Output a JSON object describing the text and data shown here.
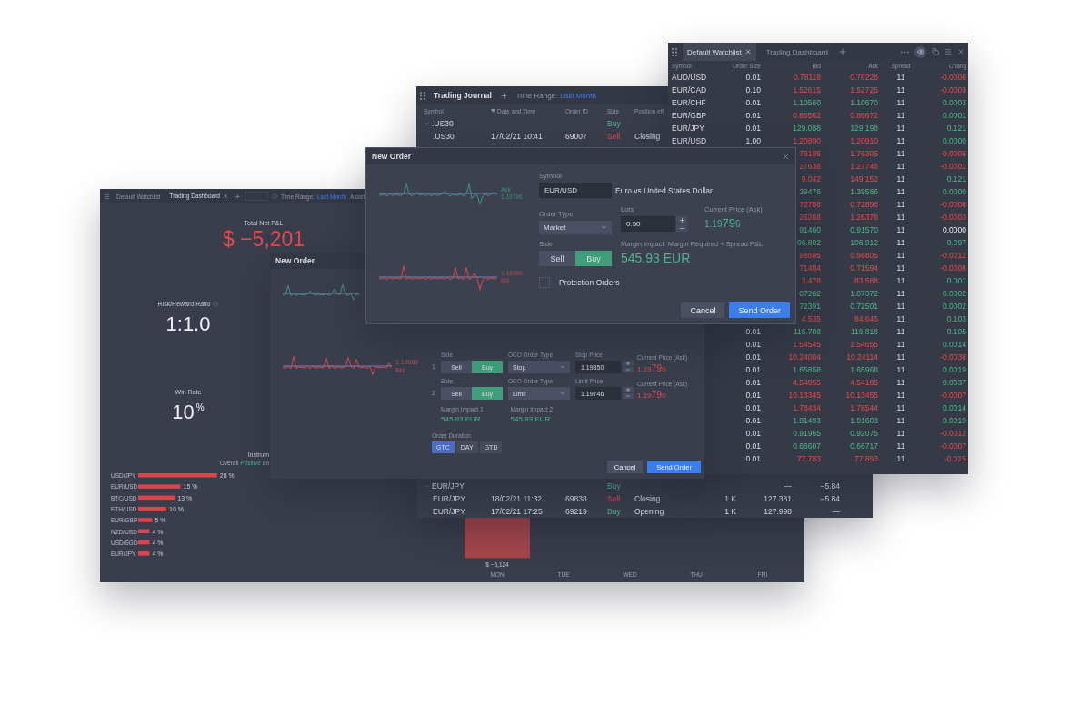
{
  "dashboard": {
    "tabs": [
      {
        "label": "Default Watchlist",
        "selected": false,
        "closable": false
      },
      {
        "label": "Trading Dashboard",
        "selected": true,
        "closable": true
      }
    ],
    "time_range": {
      "label": "Time Range:",
      "value": "Last Month"
    },
    "asset_label": "Asset",
    "total_pnl": {
      "label": "Total Net P&L",
      "value": "$ −5,201"
    },
    "risk_reward": {
      "label": "Risk/Reward Ratio",
      "value": "1:1.0"
    },
    "win_rate": {
      "label": "Win Rate",
      "value": "10",
      "unit": "%"
    },
    "instruments": {
      "title": "Instrum",
      "summary": [
        {
          "text": "Overall",
          "highlighted": false
        },
        {
          "text": "Positive",
          "highlighted": true
        },
        {
          "text": "an",
          "highlighted": false
        }
      ],
      "chart_data": {
        "type": "bar",
        "orientation": "horizontal",
        "categories": [
          "USD/JPY",
          "EUR/USD",
          "BTC/USD",
          "ETH/USD",
          "EUR/GBP",
          "NZD/USD",
          "USD/SGD",
          "EUR/JPY"
        ],
        "values": [
          28,
          15,
          13,
          10,
          5,
          4,
          4,
          4
        ],
        "value_labels": [
          "28 %",
          "15 %",
          "13 %",
          "10 %",
          "5 %",
          "4 %",
          "4 %",
          "4 %"
        ]
      }
    },
    "daily_chart": {
      "chart_data": {
        "type": "bar",
        "categories": [
          "MON",
          "TUE",
          "WED",
          "THU",
          "FRI"
        ],
        "values": [
          -5124,
          null,
          null,
          null,
          null
        ],
        "value_labels": [
          "$ −5,124",
          null,
          null,
          null,
          null
        ]
      }
    }
  },
  "journal": {
    "title": "Trading Journal",
    "time_range": {
      "label": "Time Range:",
      "value": "Last Month"
    },
    "columns": [
      {
        "label": "Symbol",
        "sorted": false
      },
      {
        "label": "Date and Time",
        "sorted": true
      },
      {
        "label": "Order ID",
        "sorted": false
      },
      {
        "label": "Side",
        "sorted": false
      },
      {
        "label": "Position eff",
        "sorted": false
      }
    ],
    "top_rows": [
      {
        "kind": "group",
        "symbol": ".US30",
        "expanded": true,
        "side": "Buy",
        "buy": true
      },
      {
        "kind": "trade",
        "symbol": ".US30",
        "time": "17/02/21 10:41",
        "order_id": "69007",
        "side": "Sell",
        "buy": false,
        "effect": "Closing"
      }
    ],
    "bottom_rows": [
      {
        "kind": "group",
        "symbol": "EUR/JPY",
        "expanded": true,
        "side": "Buy",
        "buy": true,
        "price": "—",
        "pnl": "−5.84"
      },
      {
        "kind": "trade",
        "symbol": "EUR/JPY",
        "time": "18/02/21 11:32",
        "order_id": "69838",
        "side": "Sell",
        "buy": false,
        "effect": "Closing",
        "quantity": "1 K",
        "price": "127.381",
        "pnl": "−5.84"
      },
      {
        "kind": "trade",
        "symbol": "EUR/JPY",
        "time": "17/02/21 17:25",
        "order_id": "69219",
        "side": "Buy",
        "buy": true,
        "effect": "Opening",
        "quantity": "1 K",
        "price": "127.998",
        "pnl": "—"
      }
    ]
  },
  "watchlist": {
    "tabs": [
      {
        "label": "Default Watchlist",
        "selected": true,
        "closable": true
      },
      {
        "label": "Trading Dashboard",
        "selected": false,
        "closable": false
      }
    ],
    "columns": [
      "Symbol",
      "Order Size",
      "Bid",
      "Ask",
      "Spread",
      "Chang"
    ],
    "rows": [
      {
        "symbol": "AUD/USD",
        "order_size": "0.01",
        "bid": "0.78118",
        "ask": "0.78228",
        "spread": "11",
        "rising": false,
        "change": {
          "value": "-0.0006",
          "rising": false,
          "flat": false
        }
      },
      {
        "symbol": "EUR/CAD",
        "order_size": "0.10",
        "bid": "1.52615",
        "ask": "1.52725",
        "spread": "11",
        "rising": false,
        "change": {
          "value": "-0.0003",
          "rising": false,
          "flat": false
        }
      },
      {
        "symbol": "EUR/CHF",
        "order_size": "0.01",
        "bid": "1.10560",
        "ask": "1.10670",
        "spread": "11",
        "rising": true,
        "change": {
          "value": "0.0003",
          "rising": true,
          "flat": false
        }
      },
      {
        "symbol": "EUR/GBP",
        "order_size": "0.01",
        "bid": "0.86562",
        "ask": "0.86672",
        "spread": "11",
        "rising": false,
        "change": {
          "value": "0.0001",
          "rising": true,
          "flat": false
        }
      },
      {
        "symbol": "EUR/JPY",
        "order_size": "0.01",
        "bid": "129.088",
        "ask": "129.198",
        "spread": "11",
        "rising": true,
        "change": {
          "value": "0.121",
          "rising": true,
          "flat": false
        }
      },
      {
        "symbol": "EUR/USD",
        "order_size": "1.00",
        "bid": "1.20800",
        "ask": "1.20910",
        "spread": "11",
        "rising": false,
        "change": {
          "value": "0.0000",
          "rising": true,
          "flat": false
        }
      },
      {
        "bid": "76195",
        "ask": "1.76305",
        "spread": "11",
        "rising": false,
        "change": {
          "value": "-0.0006",
          "rising": false,
          "flat": false
        }
      },
      {
        "bid": "27636",
        "ask": "1.27746",
        "spread": "11",
        "rising": false,
        "change": {
          "value": "-0.0001",
          "rising": false,
          "flat": false
        }
      },
      {
        "bid": "9.042",
        "ask": "149.152",
        "spread": "11",
        "rising": false,
        "change": {
          "value": "0.121",
          "rising": true,
          "flat": false
        }
      },
      {
        "bid": "39476",
        "ask": "1.39586",
        "spread": "11",
        "rising": true,
        "change": {
          "value": "0.0000",
          "rising": true,
          "flat": false
        }
      },
      {
        "bid": "72788",
        "ask": "0.72898",
        "spread": "11",
        "rising": false,
        "change": {
          "value": "-0.0008",
          "rising": false,
          "flat": false
        }
      },
      {
        "bid": "26268",
        "ask": "1.26378",
        "spread": "11",
        "rising": false,
        "change": {
          "value": "-0.0003",
          "rising": false,
          "flat": false
        }
      },
      {
        "bid": "91460",
        "ask": "0.91570",
        "spread": "11",
        "rising": true,
        "change": {
          "value": "0.0000",
          "flat": true
        }
      },
      {
        "bid": "06.802",
        "ask": "106.912",
        "spread": "11",
        "rising": true,
        "change": {
          "value": "0.097",
          "rising": true,
          "flat": false
        }
      },
      {
        "bid": "98695",
        "ask": "0.98805",
        "spread": "11",
        "rising": false,
        "change": {
          "value": "-0.0012",
          "rising": false,
          "flat": false
        }
      },
      {
        "bid": "71484",
        "ask": "0.71594",
        "spread": "11",
        "rising": false,
        "change": {
          "value": "-0.0006",
          "rising": false,
          "flat": false
        }
      },
      {
        "bid": "3.478",
        "ask": "83.588",
        "spread": "11",
        "rising": false,
        "change": {
          "value": "0.001",
          "rising": true,
          "flat": false
        }
      },
      {
        "bid": "07262",
        "ask": "1.07372",
        "spread": "11",
        "rising": true,
        "change": {
          "value": "0.0002",
          "rising": true,
          "flat": false
        }
      },
      {
        "bid": "72391",
        "ask": "0.72501",
        "spread": "11",
        "rising": true,
        "change": {
          "value": "0.0002",
          "rising": true,
          "flat": false
        }
      },
      {
        "bid": "4.535",
        "ask": "84.645",
        "spread": "11",
        "rising": false,
        "change": {
          "value": "0.103",
          "rising": true,
          "flat": false
        }
      },
      {
        "order_size": "0.01",
        "bid": "116.708",
        "ask": "116.818",
        "spread": "11",
        "rising": true,
        "change": {
          "value": "0.105",
          "rising": true,
          "flat": false
        }
      },
      {
        "order_size": "0.01",
        "bid": "1.54545",
        "ask": "1.54655",
        "spread": "11",
        "rising": false,
        "change": {
          "value": "0.0014",
          "rising": true,
          "flat": false
        }
      },
      {
        "order_size": "0.01",
        "bid": "10.24004",
        "ask": "10.24114",
        "spread": "11",
        "rising": false,
        "change": {
          "value": "-0.0038",
          "rising": false,
          "flat": false
        }
      },
      {
        "order_size": "0.01",
        "bid": "1.65858",
        "ask": "1.65968",
        "spread": "11",
        "rising": true,
        "change": {
          "value": "0.0019",
          "rising": true,
          "flat": false
        }
      },
      {
        "order_size": "0.01",
        "bid": "4.54055",
        "ask": "4.54165",
        "spread": "11",
        "rising": false,
        "change": {
          "value": "0.0037",
          "rising": true,
          "flat": false
        }
      },
      {
        "order_size": "0.01",
        "bid": "10.13345",
        "ask": "10.13455",
        "spread": "11",
        "rising": false,
        "change": {
          "value": "-0.0007",
          "rising": false,
          "flat": false
        }
      },
      {
        "order_size": "0.01",
        "bid": "1.78434",
        "ask": "1.78544",
        "spread": "11",
        "rising": false,
        "change": {
          "value": "0.0014",
          "rising": true,
          "flat": false
        }
      },
      {
        "order_size": "0.01",
        "bid": "1.91493",
        "ask": "1.91603",
        "spread": "11",
        "rising": true,
        "change": {
          "value": "0.0019",
          "rising": true,
          "flat": false
        }
      },
      {
        "order_size": "0.01",
        "bid": "0.91965",
        "ask": "0.92075",
        "spread": "11",
        "rising": true,
        "change": {
          "value": "-0.0012",
          "rising": false,
          "flat": false
        }
      },
      {
        "order_size": "0.01",
        "bid": "0.66607",
        "ask": "0.66717",
        "spread": "11",
        "rising": true,
        "change": {
          "value": "-0.0007",
          "rising": false,
          "flat": false
        }
      },
      {
        "order_size": "0.01",
        "bid": "77.783",
        "ask": "77.893",
        "spread": "11",
        "rising": false,
        "change": {
          "value": "-0.015",
          "rising": false,
          "flat": false
        }
      }
    ]
  },
  "oco_order_dialog": {
    "title": "New Order",
    "bid_label": "1.19680",
    "bid_caption": "Bid",
    "legs": [
      {
        "number": "1",
        "side_label": "Side",
        "sides": [
          {
            "label": "Sell",
            "selected": false
          },
          {
            "label": "Buy",
            "selected": true
          }
        ],
        "type_label": "OCO Order Type",
        "type": "Stop",
        "price_label": "Stop Price",
        "price": "1.19850",
        "current_label": "Current Price (Ask)",
        "current": {
          "lead": "1.19",
          "pips": "79",
          "tail": "0"
        },
        "rising": false
      },
      {
        "number": "2",
        "side_label": "Side",
        "sides": [
          {
            "label": "Sell",
            "selected": false
          },
          {
            "label": "Buy",
            "selected": true
          }
        ],
        "type_label": "OCO Order Type",
        "type": "Limit",
        "price_label": "Limit Price",
        "price": "1.19746",
        "current_label": "Current Price (Ask)",
        "current": {
          "lead": "1.19",
          "pips": "79",
          "tail": "0"
        },
        "rising": false
      }
    ],
    "margins": [
      {
        "label": "Margin Impact 1",
        "value": "545.93 EUR"
      },
      {
        "label": "Margin Impact 2",
        "value": "545.93 EUR"
      }
    ],
    "duration_label": "Order Duration",
    "durations": [
      {
        "label": "GTC",
        "selected": true
      },
      {
        "label": "DAY",
        "selected": false
      },
      {
        "label": "GTD",
        "selected": false
      }
    ],
    "buttons": [
      {
        "label": "Cancel",
        "kind": "secondary"
      },
      {
        "label": "Send Order",
        "kind": "primary"
      }
    ]
  },
  "order_dialog": {
    "title": "New Order",
    "ask_caption": "Ask",
    "ask_label": "1.19796",
    "bid_label": "1.19686",
    "bid_caption": "Bid",
    "symbol_label": "Symbol",
    "symbol": "EUR/USD",
    "symbol_name": "Euro vs United States Dollar",
    "order_type_label": "Order Type",
    "order_type": "Market",
    "lots_label": "Lots",
    "lots": "0.50",
    "current_label": "Current Price (Ask)",
    "current": {
      "lead": "1.19",
      "pips": "79",
      "tail": "6"
    },
    "rising": true,
    "side_label": "Side",
    "sides": [
      {
        "label": "Sell",
        "selected": false
      },
      {
        "label": "Buy",
        "selected": true
      }
    ],
    "margin_label": "Margin Impact: Margin Required + Spread P&L",
    "margin_value": "545.93 EUR",
    "protection": {
      "label": "Protection Orders",
      "checked": false
    },
    "buttons": [
      {
        "label": "Cancel",
        "kind": "secondary"
      },
      {
        "label": "Send Order",
        "kind": "primary"
      }
    ]
  }
}
